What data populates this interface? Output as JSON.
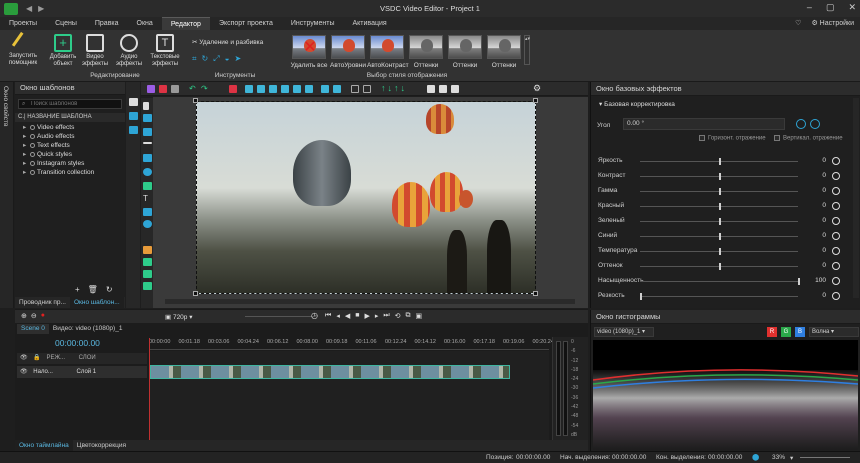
{
  "window": {
    "title": "VSDC Video Editor - Project 1"
  },
  "menu": {
    "items": [
      "Проекты",
      "Сцены",
      "Правка",
      "Окна",
      "Редактор",
      "Экспорт проекта",
      "Инструменты",
      "Активация"
    ],
    "active_index": 4,
    "settings_label": "Настройки"
  },
  "ribbon": {
    "groups": {
      "editing": "Редактирование",
      "tools": "Инструменты",
      "style": "Выбор стиля отображения"
    },
    "buttons": {
      "launch": "Запустить помощник",
      "add": "Добавить объект",
      "video_fx": "Видео эффекты",
      "audio_fx": "Аудио эффекты",
      "text_fx": "Текстовые эффекты"
    },
    "tools_label": "Удаление и разбивка",
    "styles": [
      "Удалить все",
      "АвтоУровни",
      "АвтоКонтраст",
      "Оттенки",
      "Оттенки",
      "Оттенки"
    ]
  },
  "left_panel": {
    "vertical_tab": "Окно свойств",
    "title": "Окно шаблонов",
    "search_placeholder": "Поиск шаблонов",
    "column_header": "С.| НАЗВАНИЕ ШАБЛОНА",
    "items": [
      "Video effects",
      "Audio effects",
      "Text effects",
      "Quick styles",
      "Instagram styles",
      "Transition collection"
    ],
    "tabs": [
      "Проводник пр...",
      "Окно шаблон..."
    ]
  },
  "preview": {
    "quality": "720p"
  },
  "right_panel": {
    "title": "Окно базовых эффектов",
    "section": "Базовая корректировка",
    "angle_label": "Угол",
    "angle_value": "0.00 °",
    "flip_h": "Горизонт. отражение",
    "flip_v": "Вертикал. отражение",
    "sliders": [
      {
        "label": "Яркость",
        "value": "0",
        "pos": 0.5
      },
      {
        "label": "Контраст",
        "value": "0",
        "pos": 0.5
      },
      {
        "label": "Гамма",
        "value": "0",
        "pos": 0.5
      },
      {
        "label": "Красный",
        "value": "0",
        "pos": 0.5
      },
      {
        "label": "Зеленый",
        "value": "0",
        "pos": 0.5
      },
      {
        "label": "Синий",
        "value": "0",
        "pos": 0.5
      },
      {
        "label": "Температура",
        "value": "0",
        "pos": 0.5
      },
      {
        "label": "Оттенок",
        "value": "0",
        "pos": 0.5
      },
      {
        "label": "Насыщенность",
        "value": "100",
        "pos": 1.0
      },
      {
        "label": "Резкость",
        "value": "0",
        "pos": 0.0
      }
    ]
  },
  "timeline": {
    "tabs": [
      "Scene 0",
      "Видео: video (1080p)_1"
    ],
    "time": "00:00:00.00",
    "ticks": [
      "00:00:00",
      "00:01.18",
      "00:03.06",
      "00:04.24",
      "00:06.12",
      "00:08.00",
      "00:09.18",
      "00:11.06",
      "00:12.24",
      "00:14.12",
      "00:16.00",
      "00:17.18",
      "00:19.06",
      "00:20.24"
    ],
    "track_header": "РЕЖ...",
    "layers_label": "СЛОИ",
    "track_name": "Нало...",
    "track_layer": "Слой 1",
    "meter_labels": [
      "0",
      "-6",
      "-12",
      "-18",
      "-24",
      "-30",
      "-36",
      "-42",
      "-48",
      "-54",
      "dB"
    ],
    "bottom_tabs": [
      "Окно таймлайна",
      "Цветокоррекция"
    ]
  },
  "histogram": {
    "title": "Окно гистограммы",
    "source": "video (1080p)_1",
    "channels": [
      "R",
      "G",
      "B"
    ],
    "mode": "Волна",
    "colors": {
      "r": "#e0312f",
      "g": "#2aa84a",
      "b": "#2f7fe0"
    }
  },
  "status": {
    "position_label": "Позиция:",
    "position": "00:00:00.00",
    "sel_start_label": "Нач. выделения:",
    "sel_start": "00:00:00.00",
    "sel_end_label": "Кон. выделения:",
    "sel_end": "00:00:00.00",
    "zoom": "33%"
  }
}
